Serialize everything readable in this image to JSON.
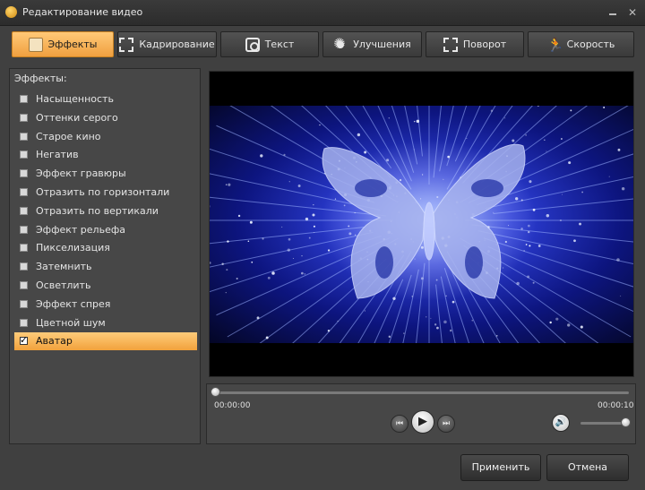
{
  "window": {
    "title": "Редактирование видео",
    "close_glyph": "✕"
  },
  "tabs": [
    {
      "label": "Эффекты",
      "icon": "effects-icon",
      "active": true
    },
    {
      "label": "Кадрирование",
      "icon": "crop-icon",
      "active": false
    },
    {
      "label": "Текст",
      "icon": "text-icon",
      "active": false
    },
    {
      "label": "Улучшения",
      "icon": "enhance-icon",
      "active": false
    },
    {
      "label": "Поворот",
      "icon": "rotate-icon",
      "active": false
    },
    {
      "label": "Скорость",
      "icon": "speed-icon",
      "active": false
    }
  ],
  "effects": {
    "heading": "Эффекты:",
    "items": [
      {
        "label": "Насыщенность",
        "checked": false
      },
      {
        "label": "Оттенки серого",
        "checked": false
      },
      {
        "label": "Старое кино",
        "checked": false
      },
      {
        "label": "Негатив",
        "checked": false
      },
      {
        "label": "Эффект гравюры",
        "checked": false
      },
      {
        "label": "Отразить по горизонтали",
        "checked": false
      },
      {
        "label": "Отразить по вертикали",
        "checked": false
      },
      {
        "label": "Эффект рельефа",
        "checked": false
      },
      {
        "label": "Пикселизация",
        "checked": false
      },
      {
        "label": "Затемнить",
        "checked": false
      },
      {
        "label": "Осветлить",
        "checked": false
      },
      {
        "label": "Эффект спрея",
        "checked": false
      },
      {
        "label": "Цветной шум",
        "checked": false
      },
      {
        "label": "Аватар",
        "checked": true
      }
    ]
  },
  "player": {
    "current_time": "00:00:00",
    "total_time": "00:00:10",
    "progress": 0,
    "volume": 1.0
  },
  "buttons": {
    "apply": "Применить",
    "cancel": "Отмена"
  },
  "colors": {
    "accent": "#f0a040",
    "background": "#404040"
  }
}
